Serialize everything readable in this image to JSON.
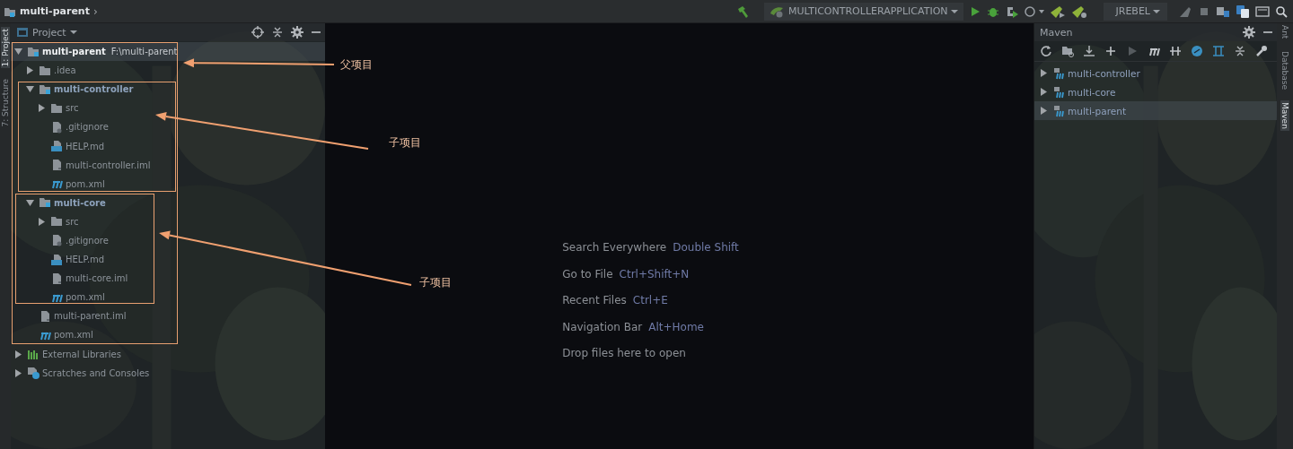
{
  "breadcrumb": {
    "label": "multi-parent",
    "separator": "›"
  },
  "toolbar": {
    "run_configuration": "MULTICONTROLLERAPPLICATION",
    "jrebel": "JREBEL"
  },
  "left_strip": [
    {
      "label": "1: Project",
      "selected": true
    },
    {
      "label": "7: Structure",
      "selected": false
    }
  ],
  "project_panel": {
    "title": "Project",
    "tree": [
      {
        "label": "multi-parent",
        "path": "F:\\multi-parent",
        "kind": "module",
        "expanded": true,
        "selected": true,
        "children": [
          {
            "label": ".idea",
            "kind": "folder",
            "expanded": false,
            "selected": false
          },
          {
            "label": "multi-controller",
            "kind": "module",
            "expanded": true,
            "selected": false,
            "children": [
              {
                "label": "src",
                "kind": "folder",
                "expanded": false,
                "selected": false
              },
              {
                "label": ".gitignore",
                "kind": "gitignore",
                "selected": false
              },
              {
                "label": "HELP.md",
                "kind": "markdown",
                "selected": false
              },
              {
                "label": "multi-controller.iml",
                "kind": "iml",
                "selected": false
              },
              {
                "label": "pom.xml",
                "kind": "maven",
                "selected": false
              }
            ]
          },
          {
            "label": "multi-core",
            "kind": "module",
            "expanded": true,
            "selected": false,
            "children": [
              {
                "label": "src",
                "kind": "folder",
                "expanded": false,
                "selected": false
              },
              {
                "label": ".gitignore",
                "kind": "gitignore",
                "selected": false
              },
              {
                "label": "HELP.md",
                "kind": "markdown",
                "selected": false
              },
              {
                "label": "multi-core.iml",
                "kind": "iml",
                "selected": false
              },
              {
                "label": "pom.xml",
                "kind": "maven",
                "selected": false
              }
            ]
          },
          {
            "label": "multi-parent.iml",
            "kind": "iml",
            "selected": false
          },
          {
            "label": "pom.xml",
            "kind": "maven",
            "selected": false
          }
        ]
      },
      {
        "label": "External Libraries",
        "kind": "libraries",
        "expanded": false,
        "selected": false
      },
      {
        "label": "Scratches and Consoles",
        "kind": "scratches",
        "expanded": false,
        "selected": false
      }
    ]
  },
  "editor": {
    "hints": [
      {
        "action": "Search Everywhere",
        "shortcut": "Double Shift"
      },
      {
        "action": "Go to File",
        "shortcut": "Ctrl+Shift+N"
      },
      {
        "action": "Recent Files",
        "shortcut": "Ctrl+E"
      },
      {
        "action": "Navigation Bar",
        "shortcut": "Alt+Home"
      },
      {
        "action": "Drop files here to open"
      }
    ]
  },
  "maven_panel": {
    "title": "Maven",
    "projects": [
      {
        "label": "multi-controller",
        "selected": false
      },
      {
        "label": "multi-core",
        "selected": false
      },
      {
        "label": "multi-parent",
        "selected": true
      }
    ]
  },
  "right_strip": [
    {
      "label": "Ant",
      "selected": false
    },
    {
      "label": "Database",
      "selected": false
    },
    {
      "label": "Maven",
      "selected": true
    }
  ],
  "annotations": [
    {
      "label": "父项目"
    },
    {
      "label": "子项目"
    },
    {
      "label": "子项目"
    }
  ]
}
